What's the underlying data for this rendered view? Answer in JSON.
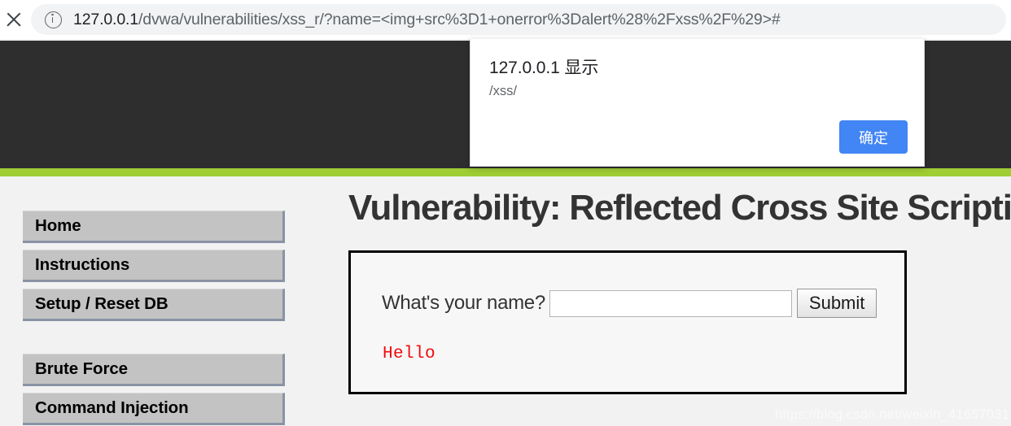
{
  "browser": {
    "close_tab_icon": "close-icon",
    "site_info_icon": "info-circle-icon",
    "url_host": "127.0.0.1",
    "url_path": "/dvwa/vulnerabilities/xss_r/?name=<img+src%3D1+onerror%3Dalert%28%2Fxss%2F%29>#",
    "url_full": "127.0.0.1/dvwa/vulnerabilities/xss_r/?name=<img+src%3D1+onerror%3Dalert%28%2Fxss%2F%29>#"
  },
  "dialog": {
    "title": "127.0.0.1 显示",
    "message": "/xss/",
    "ok_label": "确定",
    "button_color": "#4285f4"
  },
  "site": {
    "header_color": "#2e2e2e",
    "accent_color": "#9fcd34",
    "background_color": "#f2f2f2"
  },
  "sidebar": {
    "items": [
      {
        "label": "Home"
      },
      {
        "label": "Instructions"
      },
      {
        "label": "Setup / Reset DB"
      },
      {
        "label": "Brute Force"
      },
      {
        "label": "Command Injection"
      }
    ]
  },
  "main": {
    "title": "Vulnerability: Reflected Cross Site Scripting (XSS)",
    "form": {
      "label": "What's your name?",
      "input_value": "",
      "input_placeholder": "",
      "submit_label": "Submit"
    },
    "output_text": "Hello",
    "output_color": "#ef0b0b"
  },
  "watermark": {
    "text": "https://blog.csdn.net/weixin_41657031"
  }
}
